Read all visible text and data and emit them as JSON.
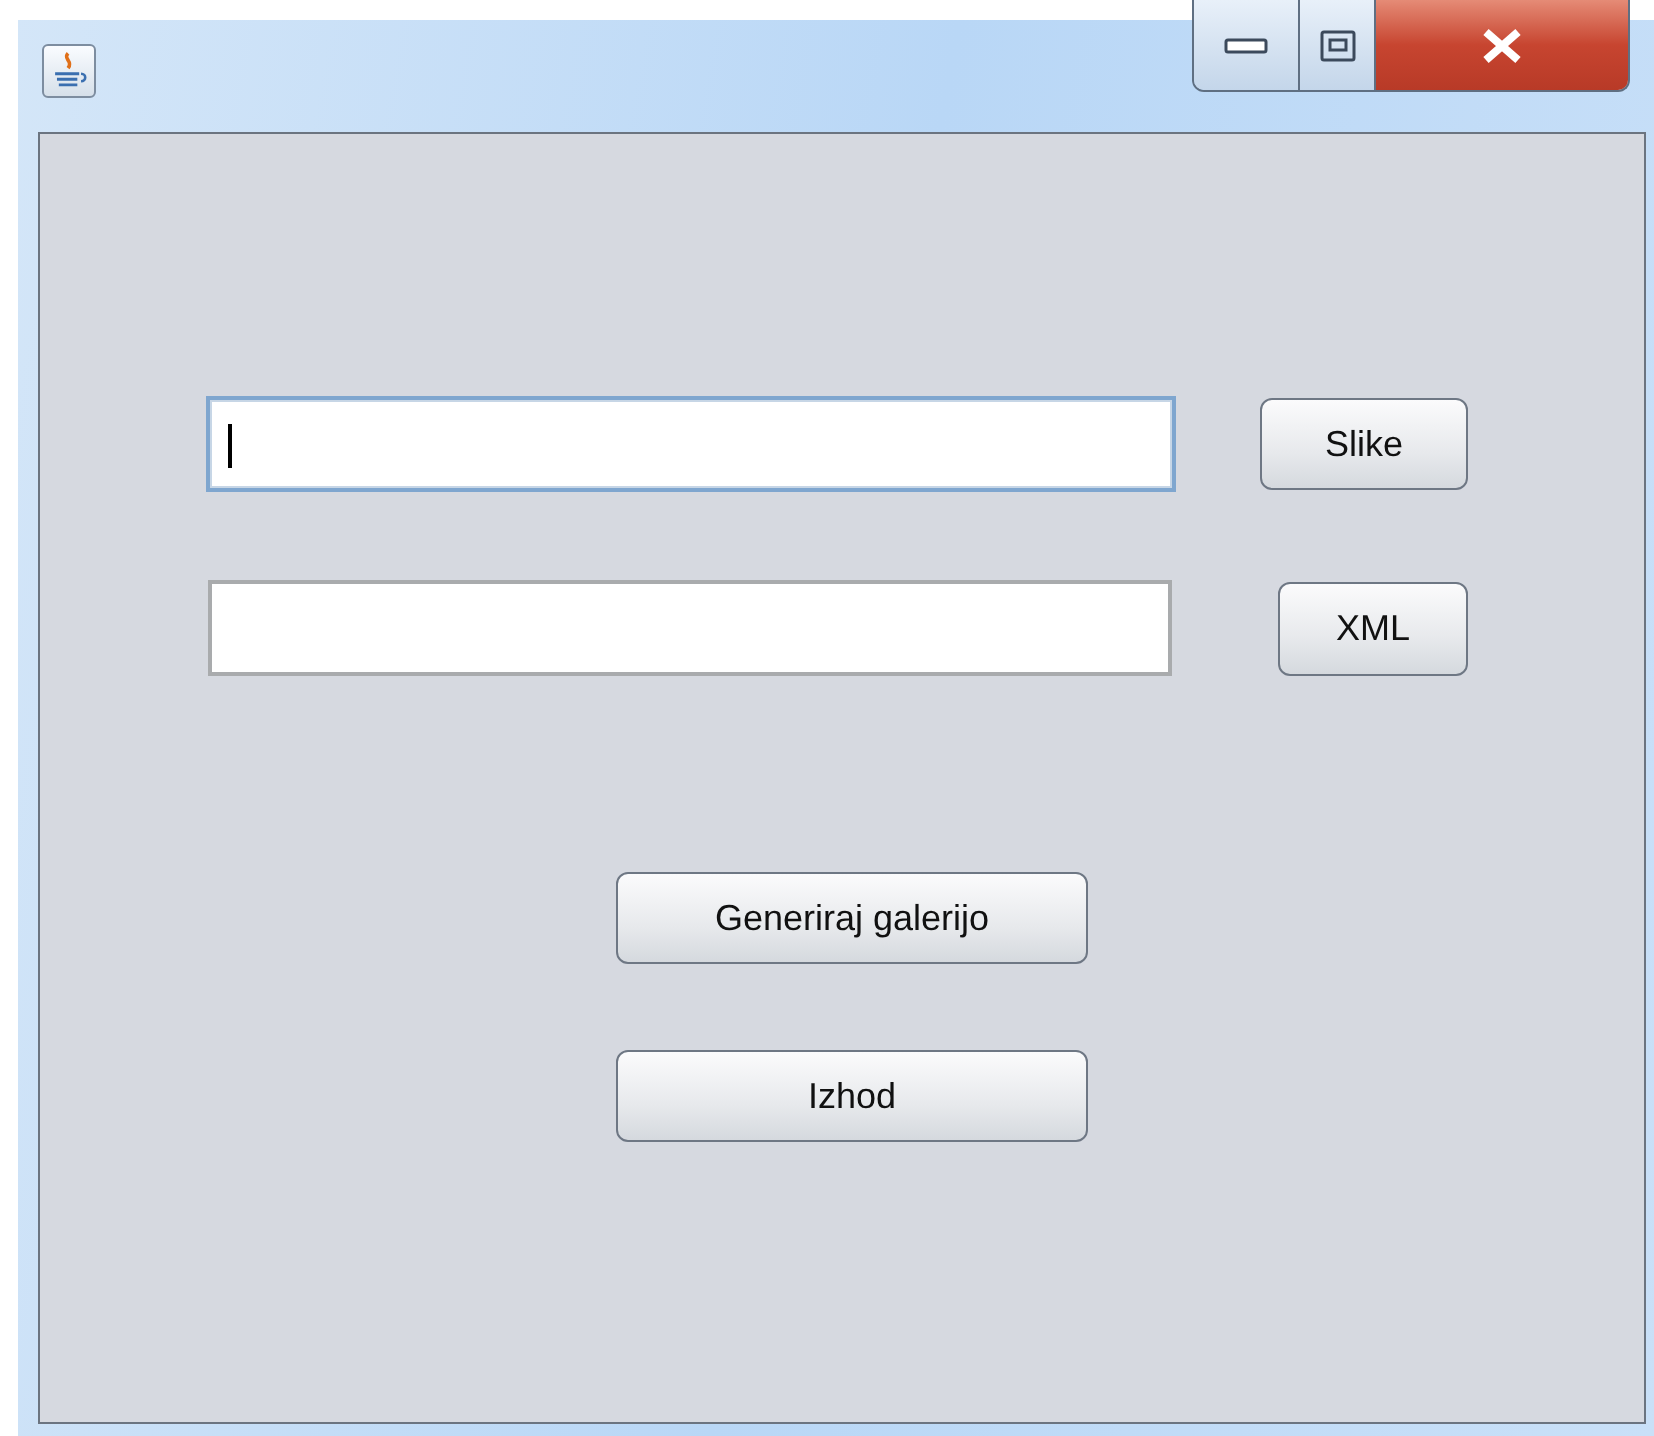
{
  "window": {
    "controls": [
      {
        "kind": "minimize"
      },
      {
        "kind": "maximize"
      },
      {
        "kind": "close"
      }
    ]
  },
  "fields": [
    {
      "focused": true,
      "button": "Slike"
    },
    {
      "focused": false,
      "button": "XML"
    }
  ],
  "buttons": [
    "Generiraj galerijo",
    "Izhod"
  ]
}
